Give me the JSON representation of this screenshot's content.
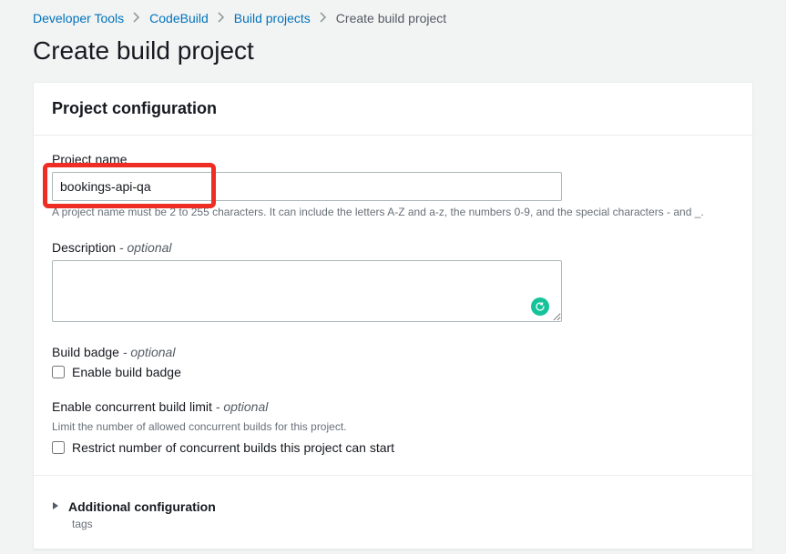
{
  "breadcrumb": {
    "items": [
      {
        "label": "Developer Tools"
      },
      {
        "label": "CodeBuild"
      },
      {
        "label": "Build projects"
      }
    ],
    "current": "Create build project"
  },
  "page": {
    "title": "Create build project"
  },
  "panel": {
    "title": "Project configuration"
  },
  "project_name": {
    "label": "Project name",
    "value": "bookings-api-qa",
    "help": "A project name must be 2 to 255 characters. It can include the letters A-Z and a-z, the numbers 0-9, and the special characters - and _."
  },
  "description": {
    "label": "Description",
    "optional": "- optional",
    "value": ""
  },
  "build_badge": {
    "label": "Build badge",
    "optional": "- optional",
    "checkbox_label": "Enable build badge"
  },
  "concurrent": {
    "label": "Enable concurrent build limit",
    "optional": "- optional",
    "help": "Limit the number of allowed concurrent builds for this project.",
    "checkbox_label": "Restrict number of concurrent builds this project can start"
  },
  "additional": {
    "title": "Additional configuration",
    "sub": "tags"
  }
}
